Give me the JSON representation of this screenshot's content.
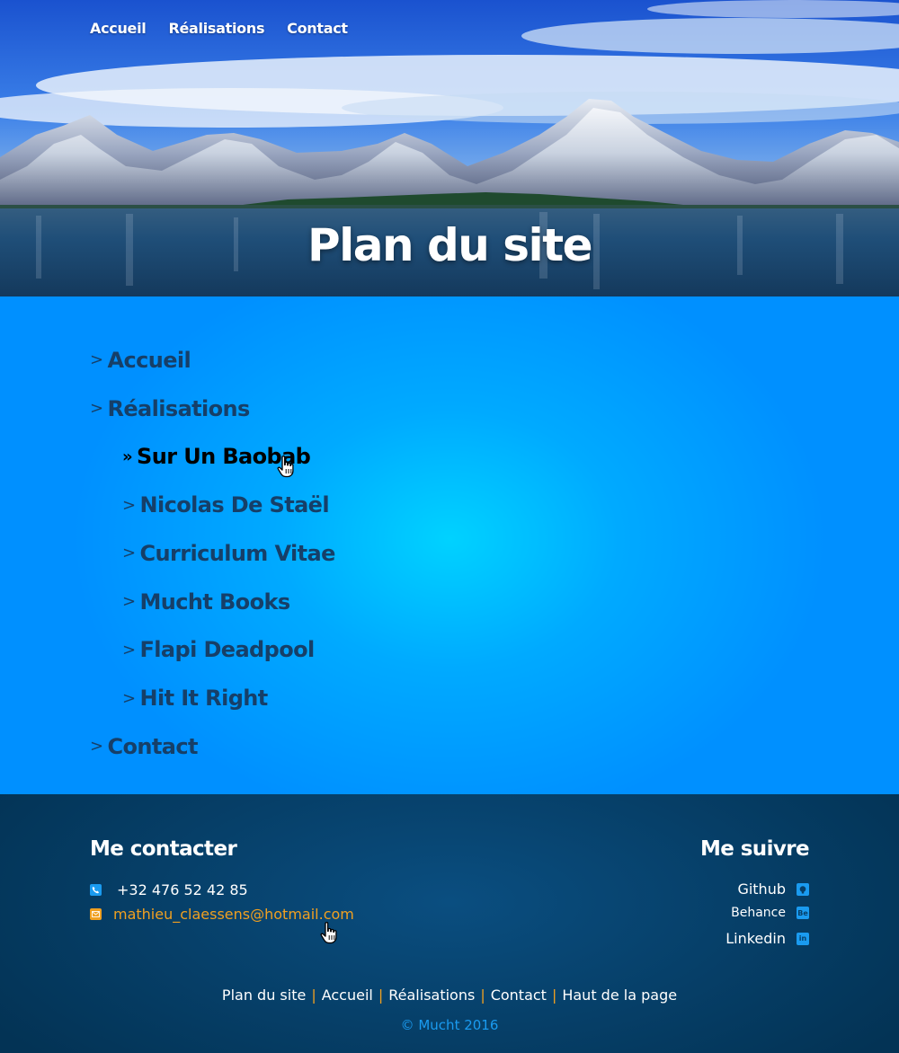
{
  "nav": {
    "items": [
      "Accueil",
      "Réalisations",
      "Contact"
    ]
  },
  "hero": {
    "title": "Plan du site"
  },
  "sitemap": {
    "chevron": ">",
    "active_chevron": "»",
    "items": [
      {
        "label": "Accueil",
        "level": 0
      },
      {
        "label": "Réalisations",
        "level": 0
      },
      {
        "label": "Sur Un Baobab",
        "level": 1,
        "active": true
      },
      {
        "label": "Nicolas De Staël",
        "level": 1
      },
      {
        "label": "Curriculum Vitae",
        "level": 1
      },
      {
        "label": "Mucht Books",
        "level": 1
      },
      {
        "label": "Flapi Deadpool",
        "level": 1
      },
      {
        "label": "Hit It Right",
        "level": 1
      },
      {
        "label": "Contact",
        "level": 0
      }
    ]
  },
  "footer": {
    "contact_title": "Me contacter",
    "phone": "+32 476 52 42 85",
    "email": "mathieu_claessens@hotmail.com",
    "follow_title": "Me suivre",
    "follow": [
      {
        "label": "Github",
        "icon": "github-icon"
      },
      {
        "label": "Behance",
        "icon": "behance-icon",
        "badge": "Be"
      },
      {
        "label": "Linkedin",
        "icon": "linkedin-icon",
        "badge": "in"
      }
    ],
    "bottom_links": [
      "Plan du site",
      "Accueil",
      "Réalisations",
      "Contact",
      "Haut de la page"
    ],
    "copyright": "© Mucht 2016"
  },
  "colors": {
    "accent_orange": "#f0a020",
    "accent_blue": "#1a9bf0",
    "sitemap_text": "#163f68"
  }
}
